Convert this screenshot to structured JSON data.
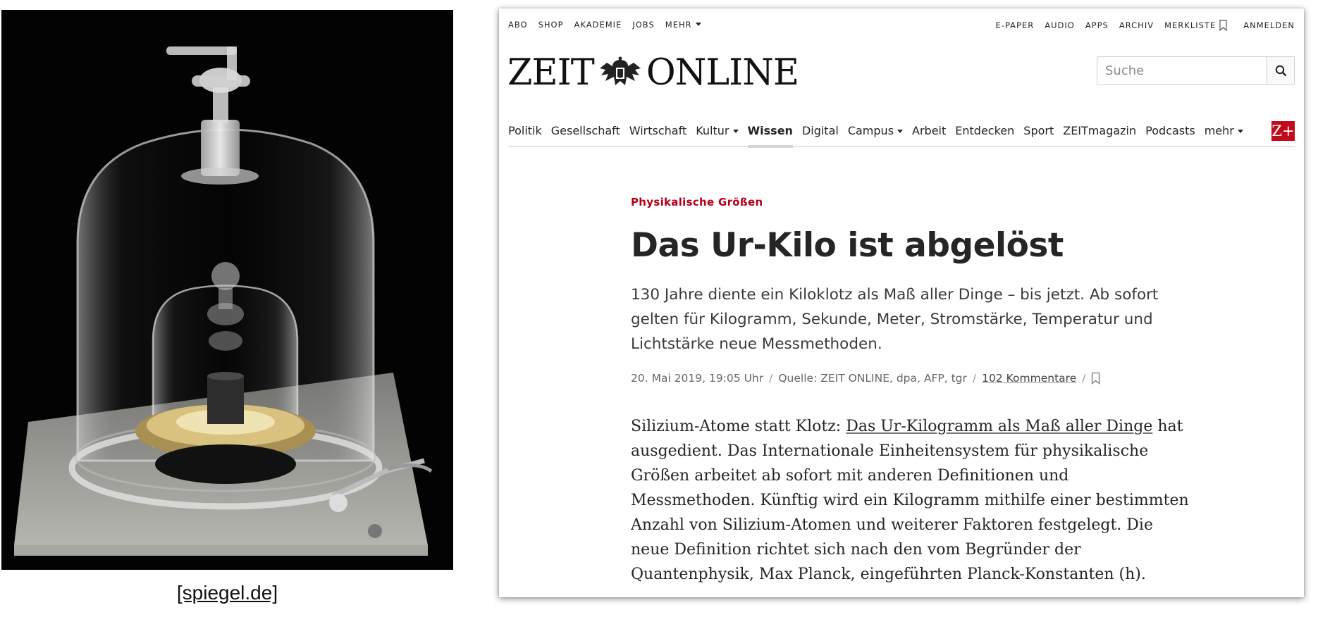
{
  "photo": {
    "caption": "[spiegel.de]"
  },
  "site": {
    "topbar_left": [
      "ABO",
      "SHOP",
      "AKADEMIE",
      "JOBS",
      "MEHR"
    ],
    "topbar_right": [
      "E-PAPER",
      "AUDIO",
      "APPS",
      "ARCHIV",
      "MERKLISTE",
      "ANMELDEN"
    ],
    "logo_left": "ZEIT",
    "logo_right": "ONLINE",
    "search_placeholder": "Suche",
    "nav": [
      "Politik",
      "Gesellschaft",
      "Wirtschaft",
      "Kultur",
      "Wissen",
      "Digital",
      "Campus",
      "Arbeit",
      "Entdecken",
      "Sport",
      "ZEITmagazin",
      "Podcasts",
      "mehr"
    ],
    "nav_active": "Wissen",
    "zplus": "Z+",
    "accent": "#b3001b",
    "zplus_color": "#c10b1d"
  },
  "article": {
    "kicker": "Physikalische Größen",
    "headline": "Das Ur-Kilo ist abgelöst",
    "summary": "130 Jahre diente ein Kiloklotz als Maß aller Dinge – bis jetzt. Ab sofort gelten für Kilogramm, Sekunde, Meter, Stromstärke, Temperatur und Lichtstärke neue Messmethoden.",
    "date": "20. Mai 2019, 19:05 Uhr",
    "source": "Quelle: ZEIT ONLINE, dpa, AFP, tgr",
    "comments": "102 Kommentare",
    "body_before": "Silizium-Atome statt Klotz: ",
    "body_link": "Das Ur-Kilogramm als Maß aller Dinge",
    "body_after": " hat ausgedient. Das Internationale Einheitensystem für physikalische Größen arbeitet ab sofort mit anderen Definitionen und Messmethoden. Künftig wird ein Kilogramm mithilfe einer bestimmten Anzahl von Silizium-Atomen und weiterer Faktoren festgelegt. Die neue Definition richtet sich nach den vom Begründer der Quantenphysik, Max Planck, eingeführten Planck-Konstanten (h)."
  }
}
